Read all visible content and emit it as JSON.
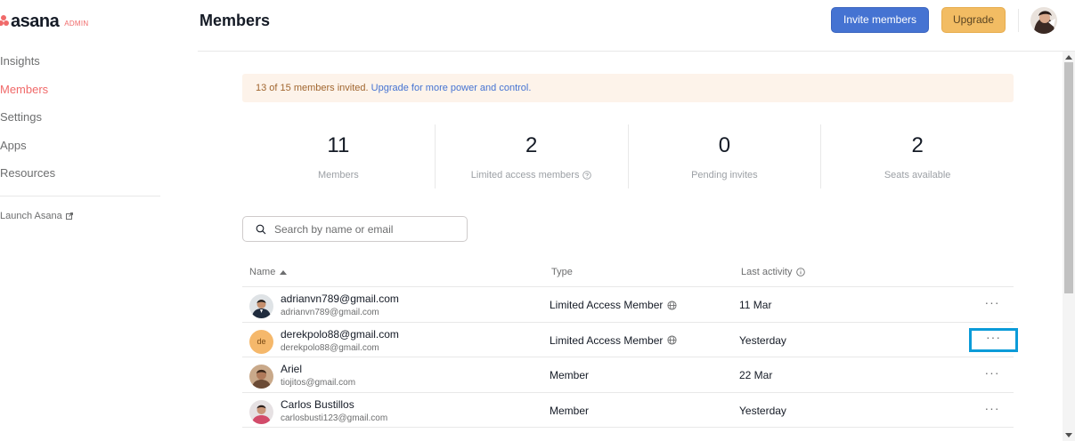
{
  "sidebar": {
    "logo_text": "asana",
    "logo_badge": "ADMIN",
    "items": [
      {
        "label": "Insights",
        "active": false
      },
      {
        "label": "Members",
        "active": true
      },
      {
        "label": "Settings",
        "active": false
      },
      {
        "label": "Apps",
        "active": false
      },
      {
        "label": "Resources",
        "active": false
      }
    ],
    "launch_label": "Launch Asana",
    "accent_color": "#f06a6a"
  },
  "header": {
    "title": "Members",
    "invite_label": "Invite members",
    "upgrade_label": "Upgrade"
  },
  "banner": {
    "text": "13 of 15 members invited.",
    "link_text": "Upgrade for more power and control."
  },
  "stats": [
    {
      "value": "11",
      "label": "Members"
    },
    {
      "value": "2",
      "label": "Limited access members"
    },
    {
      "value": "0",
      "label": "Pending invites"
    },
    {
      "value": "2",
      "label": "Seats available"
    }
  ],
  "search": {
    "placeholder": "Search by name or email"
  },
  "table": {
    "columns": {
      "name": "Name",
      "type": "Type",
      "activity": "Last activity"
    },
    "rows": [
      {
        "name": "adrianvn789@gmail.com",
        "email": "adrianvn789@gmail.com",
        "type": "Limited Access Member",
        "activity": "11 Mar"
      },
      {
        "name": "derekpolo88@gmail.com",
        "email": "derekpolo88@gmail.com",
        "initials": "de",
        "type": "Limited Access Member",
        "activity": "Yesterday"
      },
      {
        "name": "Ariel",
        "email": "tiojitos@gmail.com",
        "type": "Member",
        "activity": "22 Mar"
      },
      {
        "name": "Carlos Bustillos",
        "email": "carlosbusti123@gmail.com",
        "type": "Member",
        "activity": "Yesterday"
      }
    ],
    "more_label": "···"
  }
}
